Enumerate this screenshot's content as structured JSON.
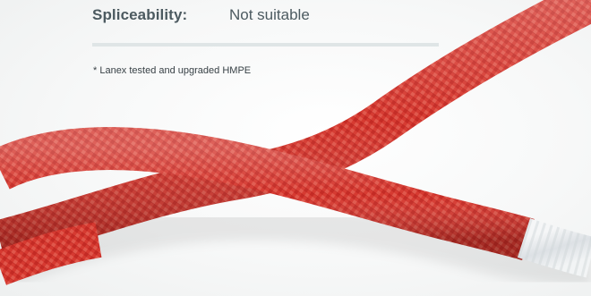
{
  "spec": {
    "label": "Spliceability:",
    "value": "Not suitable"
  },
  "footnote": "* Lanex tested and upgraded HMPE",
  "colors": {
    "text": "#4c5a60",
    "divider": "#dfe5e6",
    "rope_red": "#d8322b",
    "rope_core": "#e9ecef"
  }
}
